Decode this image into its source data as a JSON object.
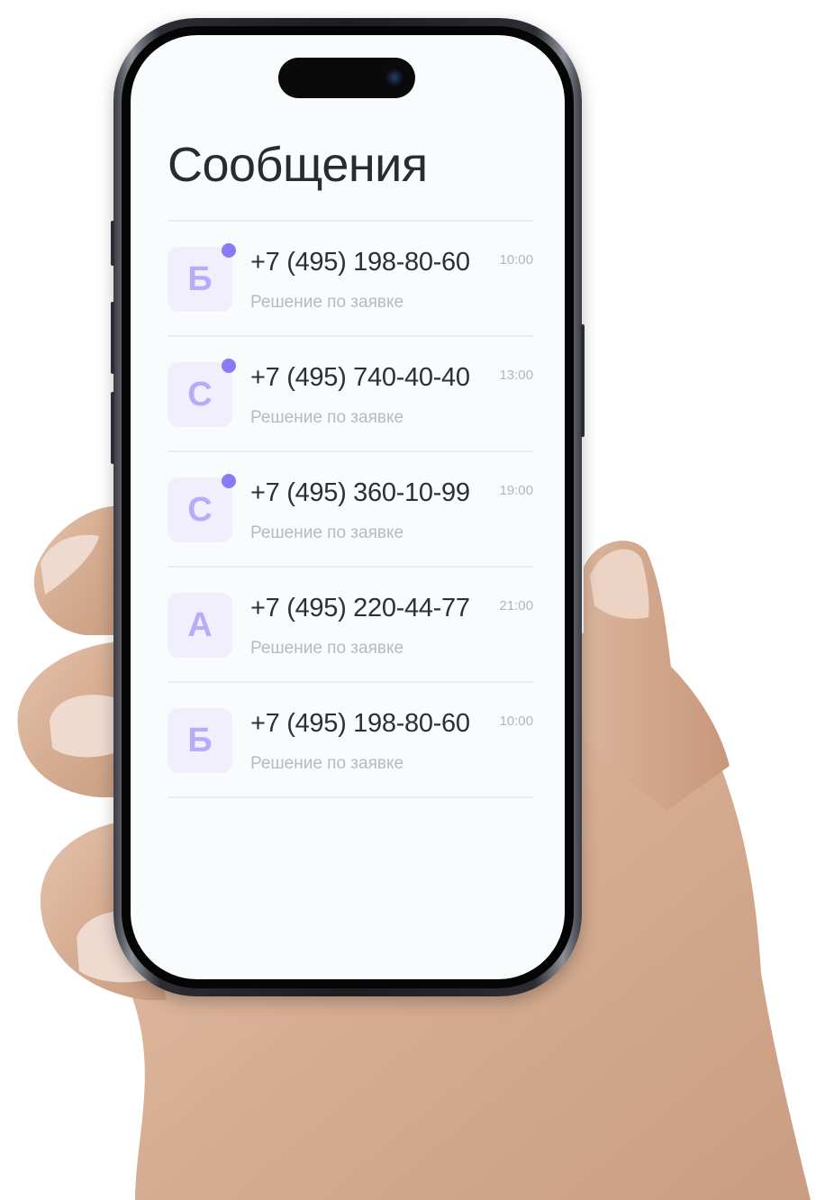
{
  "screen": {
    "title": "Сообщения",
    "conversations": [
      {
        "initial": "Б",
        "phone": "+7 (495) 198-80-60",
        "preview": "Решение по заявке",
        "time": "10:00",
        "unread": true
      },
      {
        "initial": "С",
        "phone": "+7 (495) 740-40-40",
        "preview": "Решение по заявке",
        "time": "13:00",
        "unread": true
      },
      {
        "initial": "С",
        "phone": "+7 (495) 360-10-99",
        "preview": "Решение по заявке",
        "time": "19:00",
        "unread": true
      },
      {
        "initial": "А",
        "phone": "+7 (495) 220-44-77",
        "preview": "Решение по заявке",
        "time": "21:00",
        "unread": false
      },
      {
        "initial": "Б",
        "phone": "+7 (495) 198-80-60",
        "preview": "Решение по заявке",
        "time": "10:00",
        "unread": false
      }
    ]
  },
  "colors": {
    "unread_dot": "#8a7af4",
    "avatar_bg": "#f1effe",
    "avatar_letter": "#b8abf7",
    "screen_bg": "#f9fcfd"
  }
}
